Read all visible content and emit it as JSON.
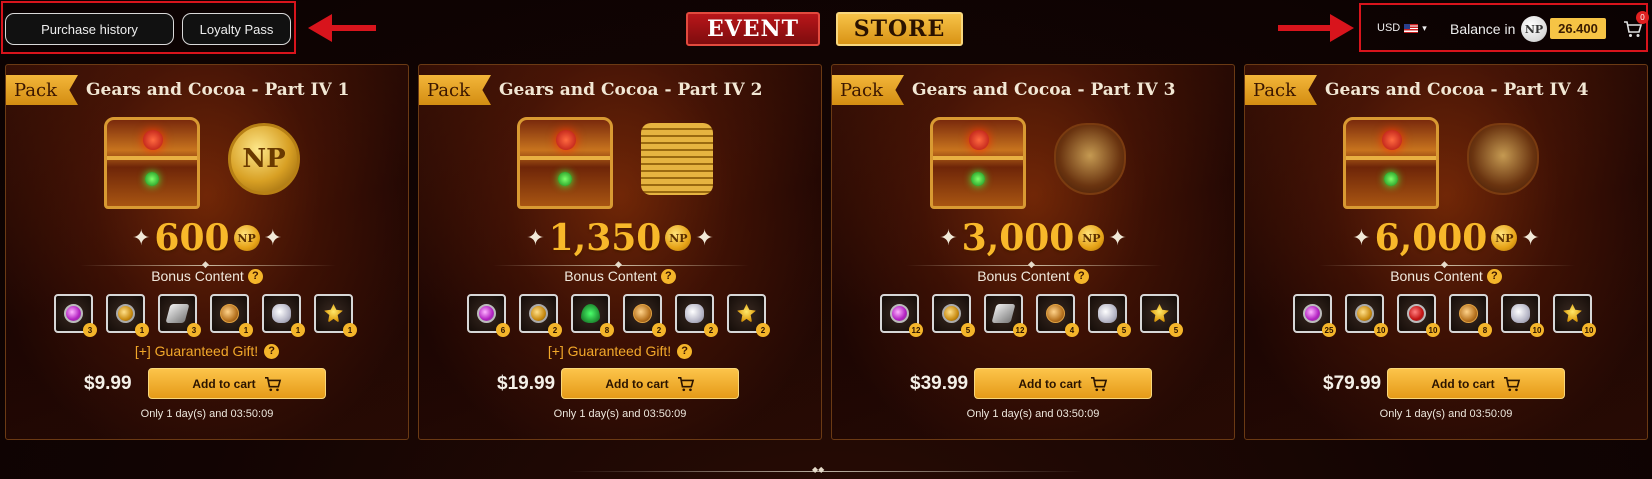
{
  "header": {
    "purchase_history_label": "Purchase history",
    "loyalty_pass_label": "Loyalty Pass",
    "tabs": [
      {
        "label": "EVENT"
      },
      {
        "label": "STORE"
      }
    ],
    "currency": "USD",
    "currency_caret": "▾",
    "balance_label": "Balance in",
    "balance_coin": "NP",
    "balance_value": "26.400",
    "cart_count": "0",
    "highlight_color": "#d8141c"
  },
  "packs": [
    {
      "tag": "Pack",
      "title": "Gears and Cocoa - Part IV 1",
      "amount": "600",
      "coin": "NP",
      "side_item": "np-coin",
      "bonus_label": "Bonus Content",
      "items": [
        {
          "icon": "purple-gem-icon",
          "qty": "3"
        },
        {
          "icon": "amber-gem-icon",
          "qty": "1"
        },
        {
          "icon": "silver-ingot-icon",
          "qty": "3"
        },
        {
          "icon": "bronze-token-icon",
          "qty": "1"
        },
        {
          "icon": "stone-icon",
          "qty": "1"
        },
        {
          "icon": "medal-icon",
          "qty": "1"
        }
      ],
      "gift_label": "[+] Guaranteed Gift!",
      "price": "$9.99",
      "cart_label": "Add to cart",
      "timer": "Only 1 day(s) and 03:50:09"
    },
    {
      "tag": "Pack",
      "title": "Gears and Cocoa - Part IV 2",
      "amount": "1,350",
      "coin": "NP",
      "side_item": "coin-stack",
      "bonus_label": "Bonus Content",
      "items": [
        {
          "icon": "purple-gem-icon",
          "qty": "6"
        },
        {
          "icon": "amber-gem-icon",
          "qty": "2"
        },
        {
          "icon": "green-crystal-icon",
          "qty": "8"
        },
        {
          "icon": "bronze-token-icon",
          "qty": "2"
        },
        {
          "icon": "stone-icon",
          "qty": "2"
        },
        {
          "icon": "medal-icon",
          "qty": "2"
        }
      ],
      "gift_label": "[+] Guaranteed Gift!",
      "price": "$19.99",
      "cart_label": "Add to cart",
      "timer": "Only 1 day(s) and 03:50:09"
    },
    {
      "tag": "Pack",
      "title": "Gears and Cocoa - Part IV 3",
      "amount": "3,000",
      "coin": "NP",
      "side_item": "gold-bag",
      "bonus_label": "Bonus Content",
      "items": [
        {
          "icon": "purple-gem-icon",
          "qty": "12"
        },
        {
          "icon": "amber-gem-icon",
          "qty": "5"
        },
        {
          "icon": "silver-ingot-icon",
          "qty": "12"
        },
        {
          "icon": "bronze-token-icon",
          "qty": "4"
        },
        {
          "icon": "stone-icon",
          "qty": "5"
        },
        {
          "icon": "medal-icon",
          "qty": "5"
        }
      ],
      "gift_label": "",
      "price": "$39.99",
      "cart_label": "Add to cart",
      "timer": "Only 1 day(s) and 03:50:09"
    },
    {
      "tag": "Pack",
      "title": "Gears and Cocoa - Part IV 4",
      "amount": "6,000",
      "coin": "NP",
      "side_item": "gold-bag",
      "bonus_label": "Bonus Content",
      "items": [
        {
          "icon": "purple-gem-icon",
          "qty": "25"
        },
        {
          "icon": "amber-gem-icon",
          "qty": "10"
        },
        {
          "icon": "red-gem-icon",
          "qty": "10"
        },
        {
          "icon": "bronze-token-icon",
          "qty": "8"
        },
        {
          "icon": "stone-icon",
          "qty": "10"
        },
        {
          "icon": "medal-icon",
          "qty": "10"
        }
      ],
      "gift_label": "",
      "price": "$79.99",
      "cart_label": "Add to cart",
      "timer": "Only 1 day(s) and 03:50:09"
    }
  ]
}
